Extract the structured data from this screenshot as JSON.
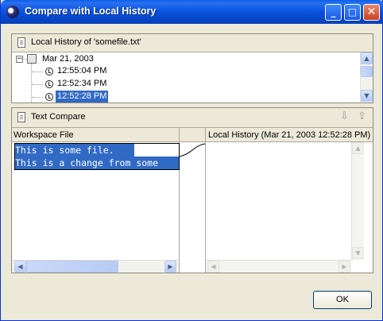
{
  "window": {
    "title": "Compare with Local History",
    "controls": {
      "minimize": "_",
      "maximize": "□",
      "close": "✕"
    }
  },
  "history": {
    "header": "Local History of 'somefile.txt'",
    "date_node": {
      "expander": "−",
      "label": "Mar 21, 2003"
    },
    "entries": [
      "12:55:04 PM",
      "12:52:34 PM",
      "12:52:28 PM"
    ],
    "selected_index": 2
  },
  "compare": {
    "header": "Text Compare",
    "nav_next": "⇩",
    "nav_prev": "⇧",
    "left_title": "Workspace File",
    "right_title": "Local History (Mar 21, 2003 12:52:28 PM)",
    "left_lines": [
      "This is some file. ",
      "This is a change from some"
    ]
  },
  "scroll_arrows": {
    "up": "▲",
    "down": "▼",
    "left": "◀",
    "right": "▶"
  },
  "buttons": {
    "ok": "OK"
  }
}
